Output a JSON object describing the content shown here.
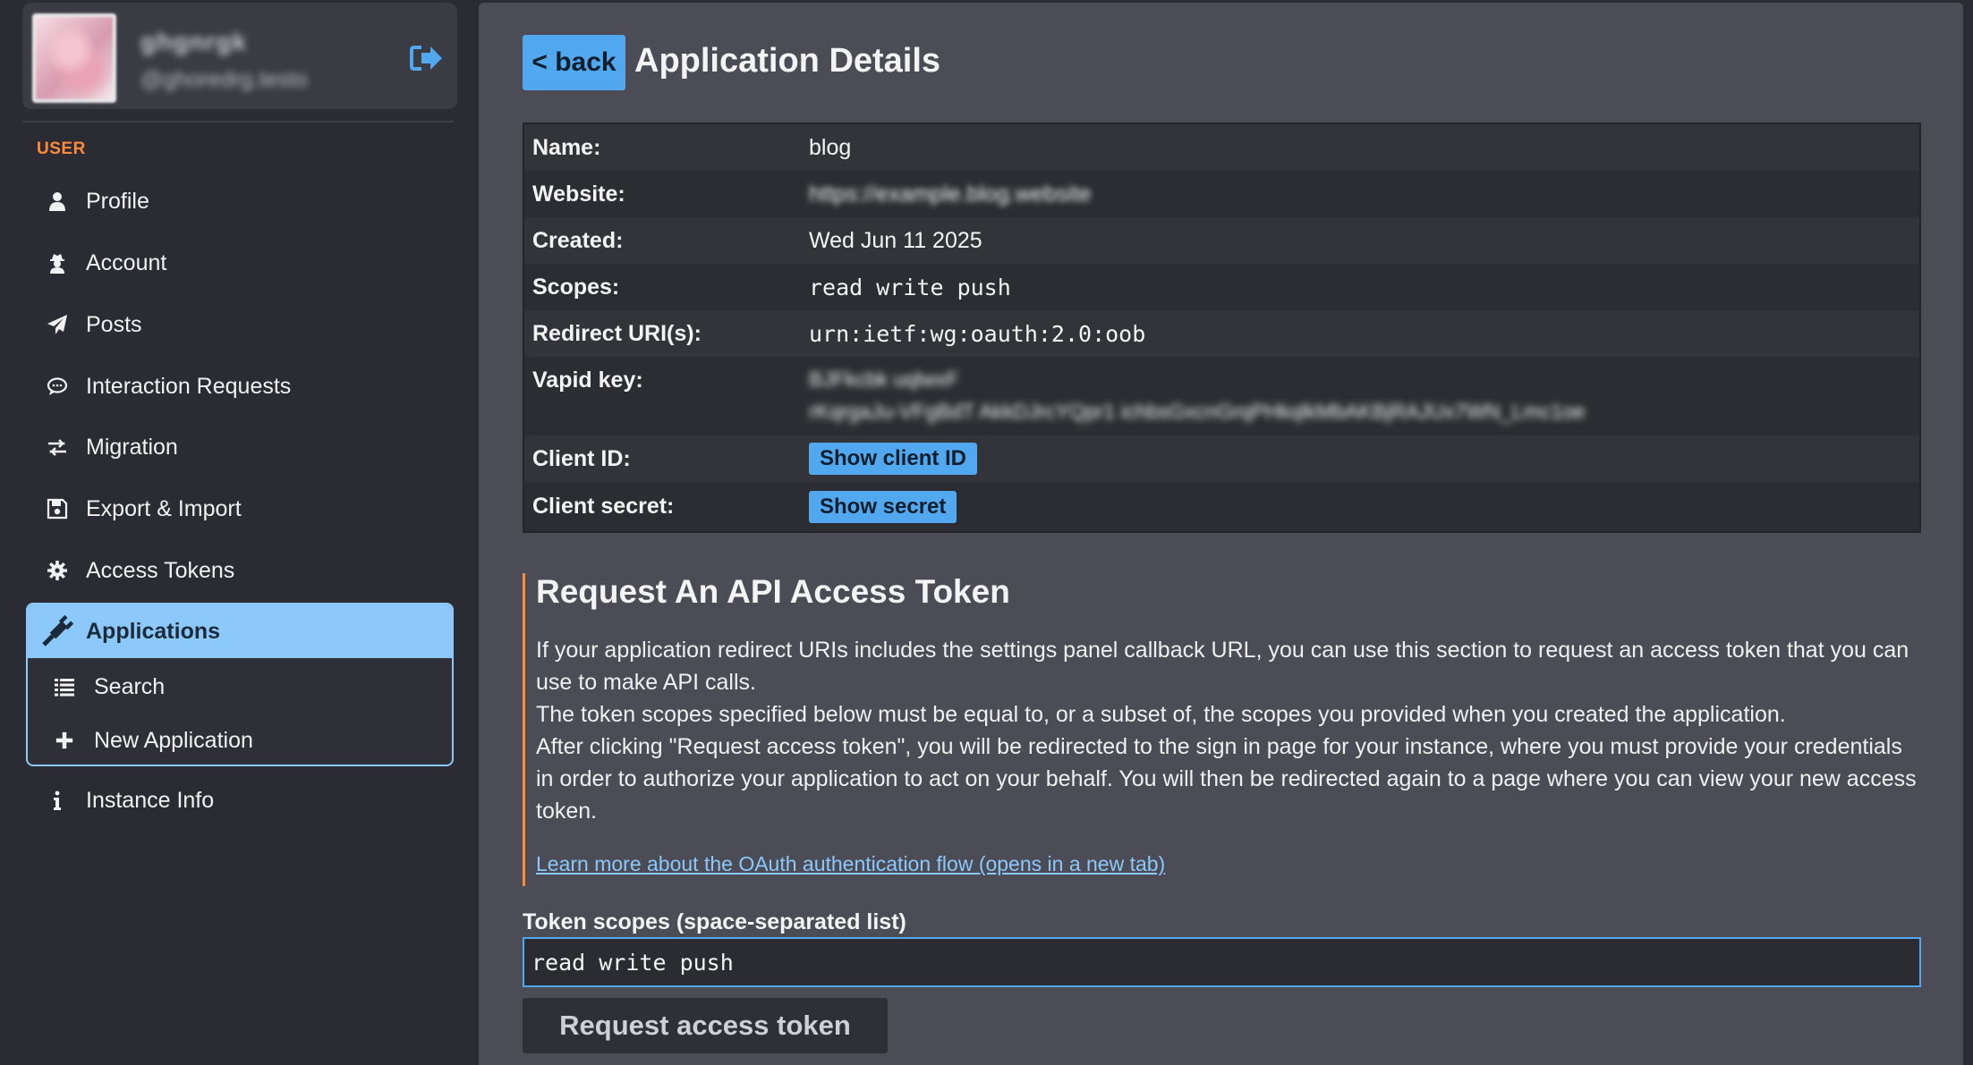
{
  "sidebar": {
    "user": {
      "display_name": "ghgnrgk",
      "handle": "@ghoredrg.testo"
    },
    "section_label": "USER",
    "items": [
      {
        "label": "Profile",
        "icon": "user-icon"
      },
      {
        "label": "Account",
        "icon": "user-secret-icon"
      },
      {
        "label": "Posts",
        "icon": "paper-plane-icon"
      },
      {
        "label": "Interaction Requests",
        "icon": "speech-bubble-icon"
      },
      {
        "label": "Migration",
        "icon": "exchange-icon"
      },
      {
        "label": "Export & Import",
        "icon": "floppy-disk-icon"
      },
      {
        "label": "Access Tokens",
        "icon": "gear-icon"
      }
    ],
    "applications": {
      "label": "Applications",
      "icon": "plug-icon",
      "subitems": [
        {
          "label": "Search",
          "icon": "list-icon"
        },
        {
          "label": "New Application",
          "icon": "plus-icon"
        }
      ]
    },
    "instance_info": {
      "label": "Instance Info",
      "icon": "info-icon"
    }
  },
  "main": {
    "back_label": "< back",
    "title": "Application Details",
    "details": {
      "name_label": "Name:",
      "name_value": "blog",
      "website_label": "Website:",
      "website_value": "https://example.blog.website",
      "created_label": "Created:",
      "created_value": "Wed Jun 11 2025",
      "scopes_label": "Scopes:",
      "scopes_value": "read write push",
      "redirect_label": "Redirect URI(s):",
      "redirect_value": "urn:ietf:wg:oauth:2.0:oob",
      "vapid_label": "Vapid key:",
      "vapid_line1": "BJFkcbk uqlwxF",
      "vapid_line2": "rKqrgaJu-VFgBdT AkkDJrcYQpr1 ichbsGxcnGrqPHkqlkMbAKBjRAJUx7WN_Lmc1oe",
      "client_id_label": "Client ID:",
      "client_id_button": "Show client ID",
      "client_secret_label": "Client secret:",
      "client_secret_button": "Show secret"
    },
    "token_section": {
      "title": "Request An API Access Token",
      "para1": "If your application redirect URIs includes the settings panel callback URL, you can use this section to request an access token that you can use to make API calls.",
      "para2": "The token scopes specified below must be equal to, or a subset of, the scopes you provided when you created the application.",
      "para3": "After clicking \"Request access token\", you will be redirected to the sign in page for your instance, where you must provide your credentials in order to authorize your application to act on your behalf. You will then be redirected again to a page where you can view your new access token.",
      "learn_more": "Learn more about the OAuth authentication flow (opens in a new tab)",
      "scopes_input_label": "Token scopes (space-separated list)",
      "scopes_input_value": "read write push",
      "request_button": "Request access token"
    }
  },
  "colors": {
    "accent_blue": "#52a8ee",
    "light_blue": "#8cc8f9",
    "orange": "#ff8a3c",
    "sidebar_bg": "#2b2c33",
    "main_bg": "#4b4c55"
  }
}
